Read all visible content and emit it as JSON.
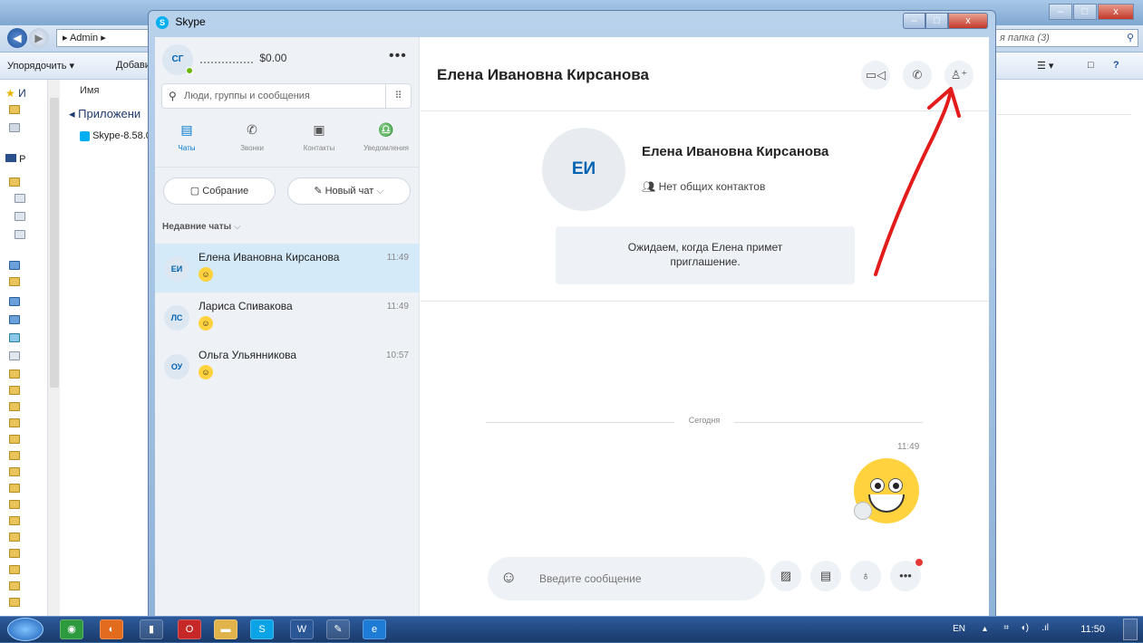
{
  "explorer": {
    "path_label": "▸ Admin ▸",
    "search_placeholder": "я папка (3)",
    "toolbar_organize": "Упорядочить ▾",
    "toolbar_add": "Добави",
    "column_name": "Имя",
    "group_label": "◂ Приложени",
    "file_label": "Skype-8.58.0",
    "left_top": "И",
    "left_p": "P"
  },
  "skype_window": {
    "title": "Skype",
    "logo_letter": "S"
  },
  "profile": {
    "initials": "СГ",
    "balance": "$0.00",
    "more": "•••"
  },
  "search": {
    "placeholder": "Люди, группы и сообщения"
  },
  "tabs": [
    {
      "label": "Чаты",
      "icon": "chat-icon"
    },
    {
      "label": "Звонки",
      "icon": "phone-icon"
    },
    {
      "label": "Контакты",
      "icon": "contacts-icon"
    },
    {
      "label": "Уведомления",
      "icon": "bell-icon"
    }
  ],
  "actions": {
    "meeting": "Собрание",
    "new_chat": "Новый чат"
  },
  "recent_label": "Недавние чаты",
  "chats": [
    {
      "initials": "ЕИ",
      "name": "Елена Ивановна Кирсанова",
      "time": "11:49"
    },
    {
      "initials": "ЛС",
      "name": "Лариса Спивакова",
      "time": "11:49"
    },
    {
      "initials": "ОУ",
      "name": "Ольга Ульянникова",
      "time": "10:57"
    }
  ],
  "conversation": {
    "title": "Елена Ивановна Кирсанова",
    "card_initials": "ЕИ",
    "card_name": "Елена Ивановна Кирсанова",
    "card_contacts": "Нет общих контактов",
    "invite_line1": "Ожидаем, когда Елена примет",
    "invite_line2": "приглашение.",
    "today": "Сегодня",
    "message_time": "11:49",
    "compose_placeholder": "Введите сообщение"
  },
  "tray": {
    "lang": "EN",
    "clock": "11:50"
  },
  "colors": {
    "accent": "#0078d4",
    "selected_chat": "#d4eaf9",
    "annotation_arrow": "#e21b1b"
  }
}
